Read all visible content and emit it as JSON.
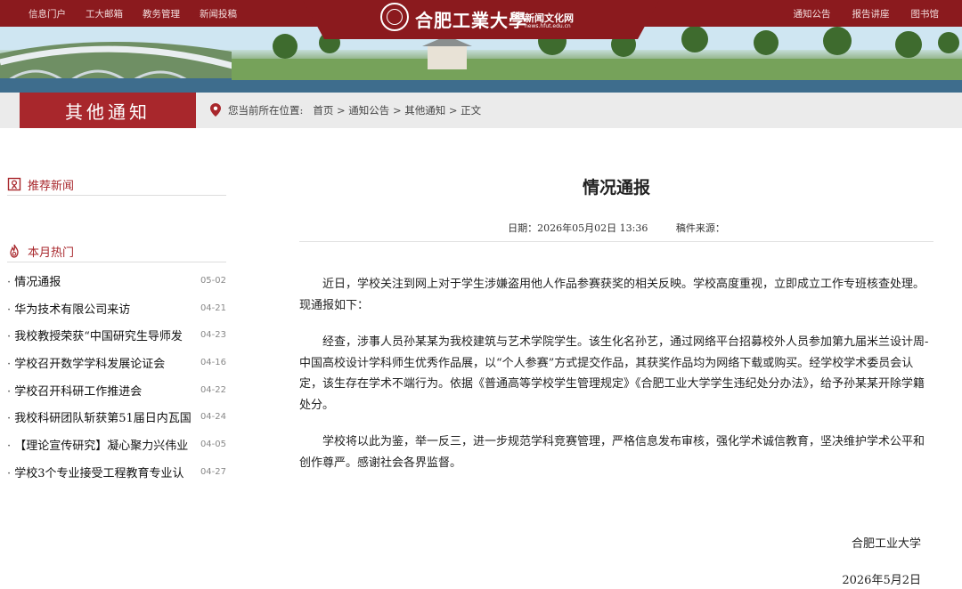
{
  "topnav_left": [
    "信息门户",
    "工大邮箱",
    "教务管理",
    "新闻投稿"
  ],
  "topnav_right": [
    "通知公告",
    "报告讲座",
    "图书馆"
  ],
  "logo": {
    "name": "合肥工業大學",
    "subtitle": "新闻文化网",
    "url": "news.hfut.edu.cn"
  },
  "section_title": "其他通知",
  "location": {
    "label": "您当前所在位置:",
    "path": "首页 > 通知公告 > 其他通知 > 正文"
  },
  "sidebar": {
    "recommend_title": "推荐新闻",
    "hot_title": "本月热门",
    "hot_items": [
      {
        "title": "情况通报",
        "date": "05-02"
      },
      {
        "title": "华为技术有限公司来访",
        "date": "04-21"
      },
      {
        "title": "我校教授荣获“中国研究生导师发",
        "date": "04-23"
      },
      {
        "title": "学校召开数学学科发展论证会",
        "date": "04-16"
      },
      {
        "title": "学校召开科研工作推进会",
        "date": "04-22"
      },
      {
        "title": "我校科研团队斩获第51届日内瓦国",
        "date": "04-24"
      },
      {
        "title": "【理论宣传研究】凝心聚力兴伟业",
        "date": "04-05"
      },
      {
        "title": "学校3个专业接受工程教育专业认",
        "date": "04-27"
      }
    ]
  },
  "article": {
    "title": "情况通报",
    "date": "日期：2026年05月02日 13:36",
    "source": "稿件来源：",
    "paragraphs": [
      "近日，学校关注到网上对于学生涉嫌盗用他人作品参赛获奖的相关反映。学校高度重视，立即成立工作专班核查处理。现通报如下：",
      "经查，涉事人员孙某某为我校建筑与艺术学院学生。该生化名孙艺，通过网络平台招募校外人员参加第九届米兰设计周-中国高校设计学科师生优秀作品展，以“个人参赛”方式提交作品，其获奖作品均为网络下载或购买。经学校学术委员会认定，该生存在学术不端行为。依据《普通高等学校学生管理规定》《合肥工业大学学生违纪处分办法》，给予孙某某开除学籍处分。",
      "学校将以此为鉴，举一反三，进一步规范学科竞赛管理，严格信息发布审核，强化学术诚信教育，坚决维护学术公平和创作尊严。感谢社会各界监督。"
    ],
    "sign_org": "合肥工业大学",
    "sign_date": "2026年5月2日"
  }
}
